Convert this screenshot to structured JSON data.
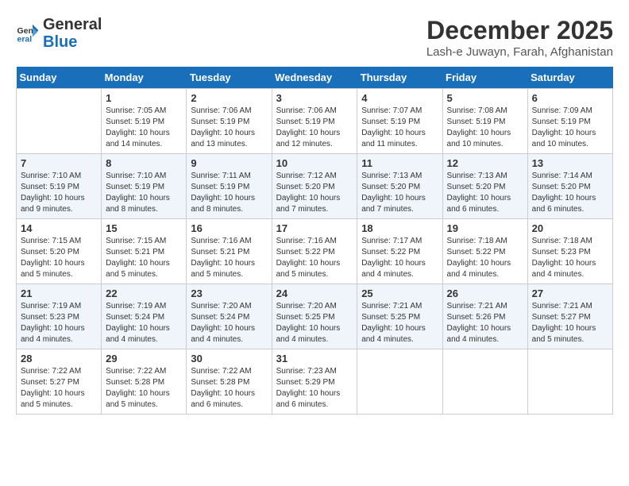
{
  "logo": {
    "line1": "General",
    "line2": "Blue"
  },
  "title": "December 2025",
  "location": "Lash-e Juwayn, Farah, Afghanistan",
  "headers": [
    "Sunday",
    "Monday",
    "Tuesday",
    "Wednesday",
    "Thursday",
    "Friday",
    "Saturday"
  ],
  "weeks": [
    [
      {
        "day": "",
        "sunrise": "",
        "sunset": "",
        "daylight": ""
      },
      {
        "day": "1",
        "sunrise": "Sunrise: 7:05 AM",
        "sunset": "Sunset: 5:19 PM",
        "daylight": "Daylight: 10 hours and 14 minutes."
      },
      {
        "day": "2",
        "sunrise": "Sunrise: 7:06 AM",
        "sunset": "Sunset: 5:19 PM",
        "daylight": "Daylight: 10 hours and 13 minutes."
      },
      {
        "day": "3",
        "sunrise": "Sunrise: 7:06 AM",
        "sunset": "Sunset: 5:19 PM",
        "daylight": "Daylight: 10 hours and 12 minutes."
      },
      {
        "day": "4",
        "sunrise": "Sunrise: 7:07 AM",
        "sunset": "Sunset: 5:19 PM",
        "daylight": "Daylight: 10 hours and 11 minutes."
      },
      {
        "day": "5",
        "sunrise": "Sunrise: 7:08 AM",
        "sunset": "Sunset: 5:19 PM",
        "daylight": "Daylight: 10 hours and 10 minutes."
      },
      {
        "day": "6",
        "sunrise": "Sunrise: 7:09 AM",
        "sunset": "Sunset: 5:19 PM",
        "daylight": "Daylight: 10 hours and 10 minutes."
      }
    ],
    [
      {
        "day": "7",
        "sunrise": "Sunrise: 7:10 AM",
        "sunset": "Sunset: 5:19 PM",
        "daylight": "Daylight: 10 hours and 9 minutes."
      },
      {
        "day": "8",
        "sunrise": "Sunrise: 7:10 AM",
        "sunset": "Sunset: 5:19 PM",
        "daylight": "Daylight: 10 hours and 8 minutes."
      },
      {
        "day": "9",
        "sunrise": "Sunrise: 7:11 AM",
        "sunset": "Sunset: 5:19 PM",
        "daylight": "Daylight: 10 hours and 8 minutes."
      },
      {
        "day": "10",
        "sunrise": "Sunrise: 7:12 AM",
        "sunset": "Sunset: 5:20 PM",
        "daylight": "Daylight: 10 hours and 7 minutes."
      },
      {
        "day": "11",
        "sunrise": "Sunrise: 7:13 AM",
        "sunset": "Sunset: 5:20 PM",
        "daylight": "Daylight: 10 hours and 7 minutes."
      },
      {
        "day": "12",
        "sunrise": "Sunrise: 7:13 AM",
        "sunset": "Sunset: 5:20 PM",
        "daylight": "Daylight: 10 hours and 6 minutes."
      },
      {
        "day": "13",
        "sunrise": "Sunrise: 7:14 AM",
        "sunset": "Sunset: 5:20 PM",
        "daylight": "Daylight: 10 hours and 6 minutes."
      }
    ],
    [
      {
        "day": "14",
        "sunrise": "Sunrise: 7:15 AM",
        "sunset": "Sunset: 5:20 PM",
        "daylight": "Daylight: 10 hours and 5 minutes."
      },
      {
        "day": "15",
        "sunrise": "Sunrise: 7:15 AM",
        "sunset": "Sunset: 5:21 PM",
        "daylight": "Daylight: 10 hours and 5 minutes."
      },
      {
        "day": "16",
        "sunrise": "Sunrise: 7:16 AM",
        "sunset": "Sunset: 5:21 PM",
        "daylight": "Daylight: 10 hours and 5 minutes."
      },
      {
        "day": "17",
        "sunrise": "Sunrise: 7:16 AM",
        "sunset": "Sunset: 5:22 PM",
        "daylight": "Daylight: 10 hours and 5 minutes."
      },
      {
        "day": "18",
        "sunrise": "Sunrise: 7:17 AM",
        "sunset": "Sunset: 5:22 PM",
        "daylight": "Daylight: 10 hours and 4 minutes."
      },
      {
        "day": "19",
        "sunrise": "Sunrise: 7:18 AM",
        "sunset": "Sunset: 5:22 PM",
        "daylight": "Daylight: 10 hours and 4 minutes."
      },
      {
        "day": "20",
        "sunrise": "Sunrise: 7:18 AM",
        "sunset": "Sunset: 5:23 PM",
        "daylight": "Daylight: 10 hours and 4 minutes."
      }
    ],
    [
      {
        "day": "21",
        "sunrise": "Sunrise: 7:19 AM",
        "sunset": "Sunset: 5:23 PM",
        "daylight": "Daylight: 10 hours and 4 minutes."
      },
      {
        "day": "22",
        "sunrise": "Sunrise: 7:19 AM",
        "sunset": "Sunset: 5:24 PM",
        "daylight": "Daylight: 10 hours and 4 minutes."
      },
      {
        "day": "23",
        "sunrise": "Sunrise: 7:20 AM",
        "sunset": "Sunset: 5:24 PM",
        "daylight": "Daylight: 10 hours and 4 minutes."
      },
      {
        "day": "24",
        "sunrise": "Sunrise: 7:20 AM",
        "sunset": "Sunset: 5:25 PM",
        "daylight": "Daylight: 10 hours and 4 minutes."
      },
      {
        "day": "25",
        "sunrise": "Sunrise: 7:21 AM",
        "sunset": "Sunset: 5:25 PM",
        "daylight": "Daylight: 10 hours and 4 minutes."
      },
      {
        "day": "26",
        "sunrise": "Sunrise: 7:21 AM",
        "sunset": "Sunset: 5:26 PM",
        "daylight": "Daylight: 10 hours and 4 minutes."
      },
      {
        "day": "27",
        "sunrise": "Sunrise: 7:21 AM",
        "sunset": "Sunset: 5:27 PM",
        "daylight": "Daylight: 10 hours and 5 minutes."
      }
    ],
    [
      {
        "day": "28",
        "sunrise": "Sunrise: 7:22 AM",
        "sunset": "Sunset: 5:27 PM",
        "daylight": "Daylight: 10 hours and 5 minutes."
      },
      {
        "day": "29",
        "sunrise": "Sunrise: 7:22 AM",
        "sunset": "Sunset: 5:28 PM",
        "daylight": "Daylight: 10 hours and 5 minutes."
      },
      {
        "day": "30",
        "sunrise": "Sunrise: 7:22 AM",
        "sunset": "Sunset: 5:28 PM",
        "daylight": "Daylight: 10 hours and 6 minutes."
      },
      {
        "day": "31",
        "sunrise": "Sunrise: 7:23 AM",
        "sunset": "Sunset: 5:29 PM",
        "daylight": "Daylight: 10 hours and 6 minutes."
      },
      {
        "day": "",
        "sunrise": "",
        "sunset": "",
        "daylight": ""
      },
      {
        "day": "",
        "sunrise": "",
        "sunset": "",
        "daylight": ""
      },
      {
        "day": "",
        "sunrise": "",
        "sunset": "",
        "daylight": ""
      }
    ]
  ]
}
